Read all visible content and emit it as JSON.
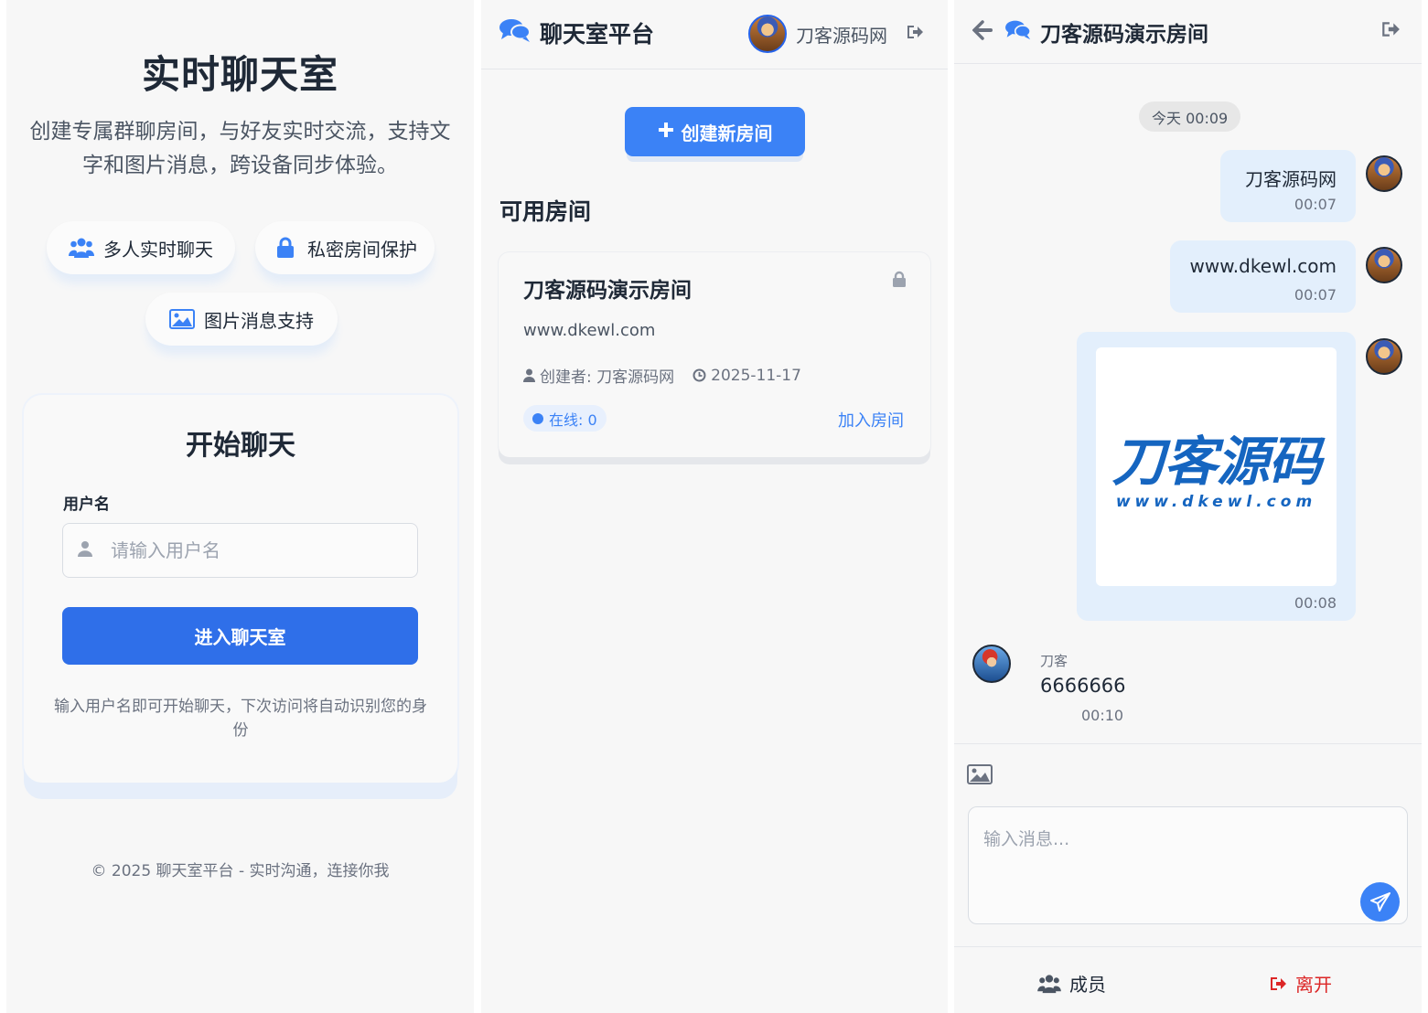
{
  "login": {
    "title": "实时聊天室",
    "subtitle": "创建专属群聊房间，与好友实时交流，支持文字和图片消息，跨设备同步体验。",
    "features": [
      {
        "icon": "users-icon",
        "label": "多人实时聊天"
      },
      {
        "icon": "lock-icon",
        "label": "私密房间保护"
      },
      {
        "icon": "image-icon",
        "label": "图片消息支持"
      }
    ],
    "card_title": "开始聊天",
    "username_label": "用户名",
    "username_placeholder": "请输入用户名",
    "enter_button": "进入聊天室",
    "hint": "输入用户名即可开始聊天，下次访问将自动识别您的身份",
    "footer": "© 2025 聊天室平台 - 实时沟通，连接你我"
  },
  "lobby": {
    "brand": "聊天室平台",
    "username": "刀客源码网",
    "create_button": "创建新房间",
    "section_title": "可用房间",
    "rooms": [
      {
        "name": "刀客源码演示房间",
        "description": "www.dkewl.com",
        "creator": "创建者: 刀客源码网",
        "date": "2025-11-17",
        "online": "在线: 0",
        "join": "加入房间"
      }
    ]
  },
  "chat": {
    "room_title": "刀客源码演示房间",
    "date_chip": "今天 00:09",
    "messages": [
      {
        "text": "刀客源码网",
        "time": "00:07",
        "side": "right"
      },
      {
        "text": "www.dkewl.com",
        "time": "00:07",
        "side": "right"
      },
      {
        "image_logo": "刀客源码",
        "image_sub": "www.dkewl.com",
        "time": "00:08",
        "side": "right"
      },
      {
        "sender": "刀客",
        "text": "6666666",
        "time": "00:10",
        "side": "left"
      }
    ],
    "input_placeholder": "输入消息...",
    "members_label": "成员",
    "leave_label": "离开"
  },
  "colors": {
    "accent": "#3b82f6",
    "primary_button": "#2f6fe9",
    "bubble": "#e3effc",
    "leave": "#dc2626"
  }
}
